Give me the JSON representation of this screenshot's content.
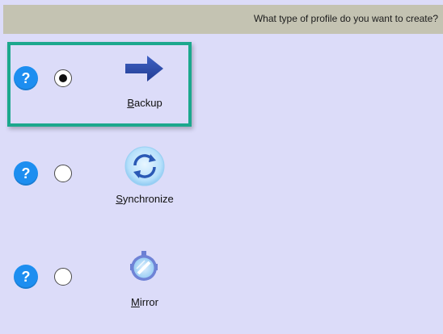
{
  "header": {
    "question": "What type of profile do you want to create?"
  },
  "options": [
    {
      "label_first": "B",
      "label_rest": "ackup",
      "selected": true,
      "icon": "arrow-right-icon",
      "help_glyph": "?"
    },
    {
      "label_first": "S",
      "label_rest": "ynchronize",
      "selected": false,
      "icon": "sync-icon",
      "help_glyph": "?"
    },
    {
      "label_first": "M",
      "label_rest": "irror",
      "selected": false,
      "icon": "mirror-icon",
      "help_glyph": "?"
    }
  ],
  "colors": {
    "background": "#dcdcf9",
    "header": "#c4c3b2",
    "highlight_border": "#1ca88d",
    "help_button": "#1d8ef0",
    "arrow": "#2848a2"
  }
}
